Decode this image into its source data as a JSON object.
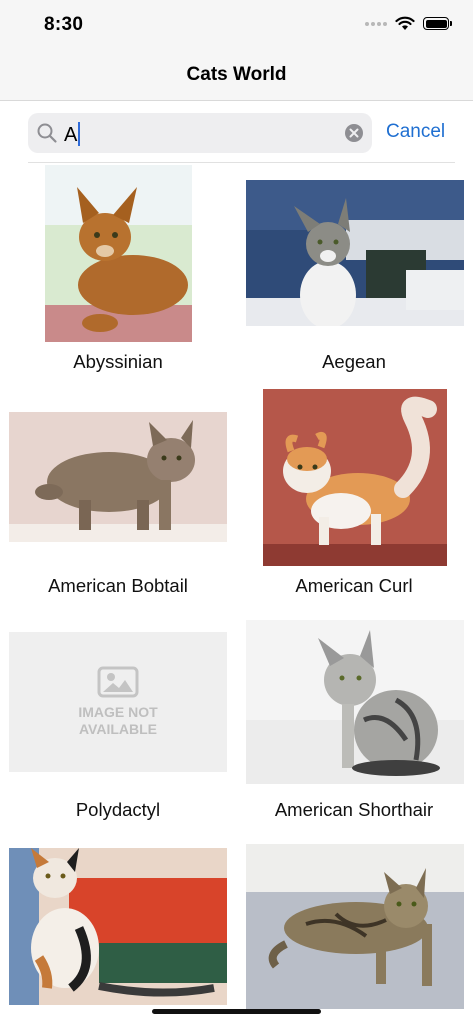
{
  "status": {
    "time": "8:30"
  },
  "nav": {
    "title": "Cats World"
  },
  "search": {
    "value": "A",
    "cancel_label": "Cancel"
  },
  "cats": [
    {
      "name": "Abyssinian"
    },
    {
      "name": "Aegean"
    },
    {
      "name": "American Bobtail"
    },
    {
      "name": "American Curl"
    },
    {
      "name": "Polydactyl",
      "image_not_available": "IMAGE NOT AVAILABLE"
    },
    {
      "name": "American Shorthair"
    },
    {
      "name": ""
    },
    {
      "name": ""
    }
  ]
}
